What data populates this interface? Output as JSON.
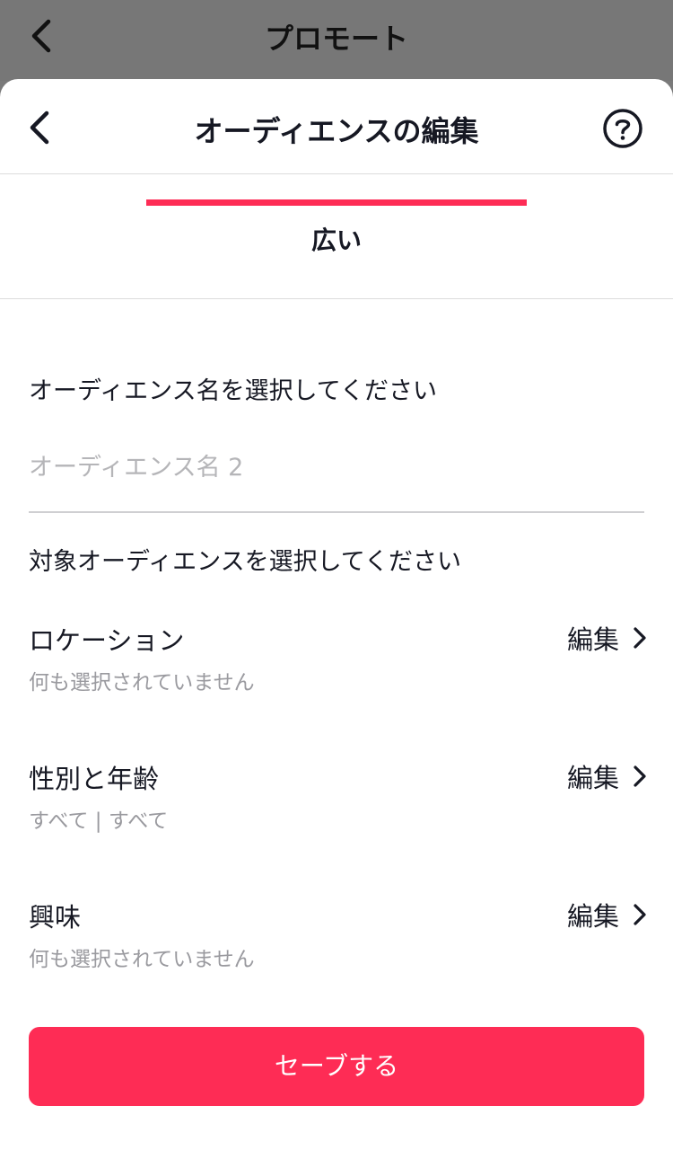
{
  "background_screen": {
    "title": "プロモート"
  },
  "sheet": {
    "title": "オーディエンスの編集",
    "tab": "広い",
    "audience_name_prompt": "オーディエンス名を選択してください",
    "audience_name_placeholder": "オーディエンス名 2",
    "target_prompt": "対象オーディエンスを選択してください",
    "rows": [
      {
        "label": "ロケーション",
        "value": "何も選択されていません",
        "edit": "編集"
      },
      {
        "label": "性別と年齢",
        "value": "すべて | すべて",
        "edit": "編集"
      },
      {
        "label": "興味",
        "value": "何も選択されていません",
        "edit": "編集"
      }
    ],
    "save_label": "セーブする"
  },
  "colors": {
    "accent": "#fe2c55",
    "text_primary": "#161823",
    "text_secondary": "#9a9a9f",
    "backdrop": "#777777"
  },
  "icons": [
    "back-arrow-icon",
    "help-circle-icon",
    "chevron-right-icon"
  ]
}
